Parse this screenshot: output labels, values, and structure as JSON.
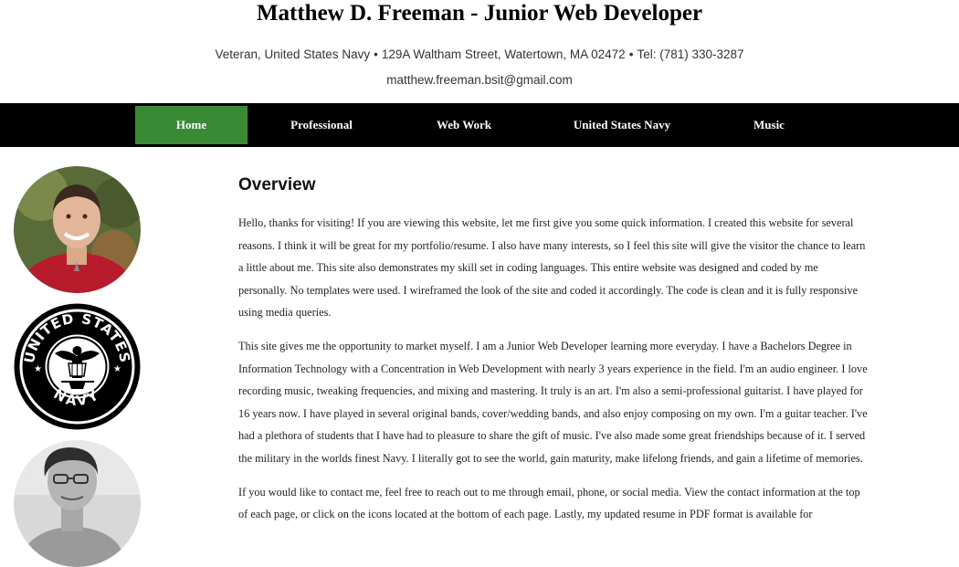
{
  "header": {
    "title": "Matthew D. Freeman - Junior Web Developer",
    "contact": {
      "rank": "Veteran, United States Navy",
      "address": "129A Waltham Street, Watertown, MA 02472",
      "phone": "Tel: (781) 330-3287",
      "separator": "•",
      "email": "matthew.freeman.bsit@gmail.com"
    }
  },
  "nav": {
    "items": [
      {
        "label": "Home",
        "active": true
      },
      {
        "label": "Professional",
        "active": false
      },
      {
        "label": "Web Work",
        "active": false
      },
      {
        "label": "United States Navy",
        "active": false
      },
      {
        "label": "Music",
        "active": false
      }
    ]
  },
  "sidebar": {
    "navy_seal_text_top": "UNITED STATES",
    "navy_seal_text_bottom": "NAVY"
  },
  "main": {
    "heading": "Overview",
    "paragraphs": [
      "Hello, thanks for visiting! If you are viewing this website, let me first give you some quick information. I created this website for several reasons. I think it will be great for my portfolio/resume. I also have many interests, so I feel this site will give the visitor the chance to learn a little about me. This site also demonstrates my skill set in coding languages. This entire website was designed and coded by me personally. No templates were used. I wireframed the look of the site and coded it accordingly. The code is clean and it is fully responsive using media queries.",
      "This site gives me the opportunity to market myself. I am a Junior Web Developer learning more everyday. I have a Bachelors Degree in Information Technology with a Concentration in Web Development with nearly 3 years experience in the field. I'm an audio engineer. I love recording music, tweaking frequencies, and mixing and mastering. It truly is an art. I'm also a semi-professional guitarist. I have played for 16 years now. I have played in several original bands, cover/wedding bands, and also enjoy composing on my own. I'm a guitar teacher. I've had a plethora of students that I have had to pleasure to share the gift of music. I've also made some great friendships because of it. I served the military in the worlds finest Navy. I literally got to see the world, gain maturity, make lifelong friends, and gain a lifetime of memories.",
      "If you would like to contact me, feel free to reach out to me through email, phone, or social media. View the contact information at the top of each page, or click on the icons located at the bottom of each page. Lastly, my updated resume in PDF format is available for"
    ]
  },
  "colors": {
    "nav_bg": "#000000",
    "nav_active": "#3a8a35",
    "text": "#222222"
  }
}
